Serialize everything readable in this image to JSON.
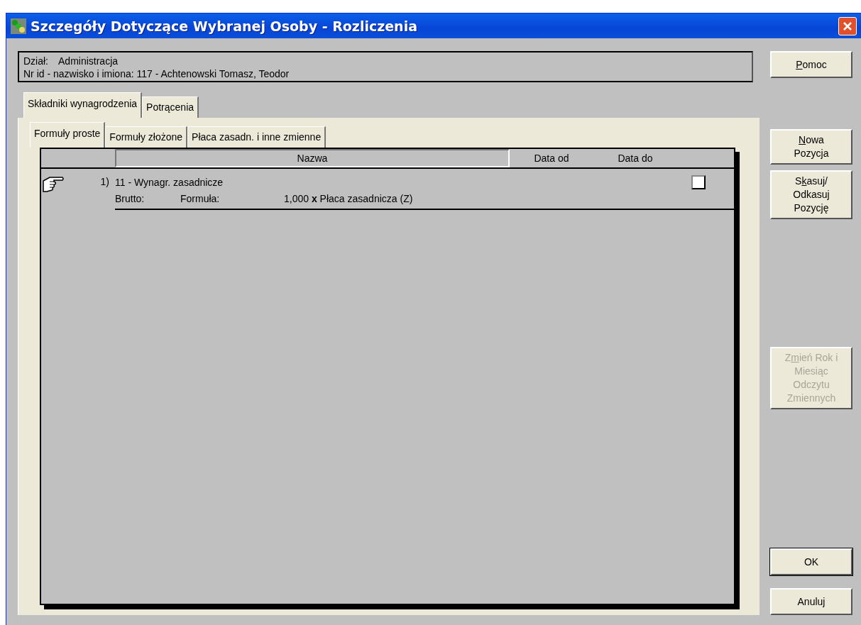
{
  "window": {
    "title": "Szczegóły Dotyczące Wybranej Osoby - Rozliczenia"
  },
  "info": {
    "department_label": "Dział:",
    "department": "Administracja",
    "person": "Nr id - nazwisko i imiona: 117 - Achtenowski Tomasz, Teodor"
  },
  "tabs": [
    {
      "label": "Składniki wynagrodzenia",
      "selected": true
    },
    {
      "label": "Potrącenia",
      "selected": false
    }
  ],
  "subtabs": [
    {
      "label": "Formuły proste",
      "selected": true
    },
    {
      "label": "Formuły złożone",
      "selected": false
    },
    {
      "label": "Płaca zasadn. i inne zmienne",
      "selected": false
    }
  ],
  "table": {
    "columns": [
      "Nazwa",
      "Data od",
      "Data do"
    ],
    "rows": [
      {
        "selected": true,
        "number": "1)",
        "name": "11 - Wynagr. zasadnicze",
        "checked": false,
        "type": "Brutto:",
        "formula_label": "Formuła:",
        "factor": "1,000",
        "operator": "x",
        "formula": "Płaca zasadnicza (Z)"
      }
    ]
  },
  "buttons": [
    {
      "kind": "top",
      "disabled": false,
      "default": false,
      "lines": [
        [
          {
            "text": "P",
            "underline": true
          },
          {
            "text": "omoc",
            "underline": false
          }
        ]
      ]
    },
    {
      "kind": "middle",
      "disabled": false,
      "default": false,
      "lines": [
        [
          {
            "text": "N",
            "underline": true
          },
          {
            "text": "owa",
            "underline": false
          }
        ],
        [
          {
            "text": "Pozycja",
            "underline": false
          }
        ]
      ]
    },
    {
      "kind": "middle",
      "disabled": false,
      "default": false,
      "lines": [
        [
          {
            "text": "S",
            "underline": false
          },
          {
            "text": "k",
            "underline": true
          },
          {
            "text": "asuj/",
            "underline": false
          }
        ],
        [
          {
            "text": "Odkasuj",
            "underline": false
          }
        ],
        [
          {
            "text": "Pozycję",
            "underline": false
          }
        ]
      ]
    },
    {
      "kind": "lower",
      "disabled": true,
      "default": false,
      "lines": [
        [
          {
            "text": "Z",
            "underline": false
          },
          {
            "text": "m",
            "underline": true
          },
          {
            "text": "ień Rok i",
            "underline": false
          }
        ],
        [
          {
            "text": "Miesiąc",
            "underline": false
          }
        ],
        [
          {
            "text": "Odczytu",
            "underline": false
          }
        ],
        [
          {
            "text": "Zmiennych",
            "underline": false
          }
        ]
      ]
    },
    {
      "kind": "bottom",
      "disabled": false,
      "default": true,
      "lines": [
        [
          {
            "text": "OK",
            "underline": false
          }
        ]
      ]
    },
    {
      "kind": "bottom",
      "disabled": false,
      "default": false,
      "lines": [
        [
          {
            "text": "Anuluj",
            "underline": false
          }
        ]
      ]
    }
  ]
}
